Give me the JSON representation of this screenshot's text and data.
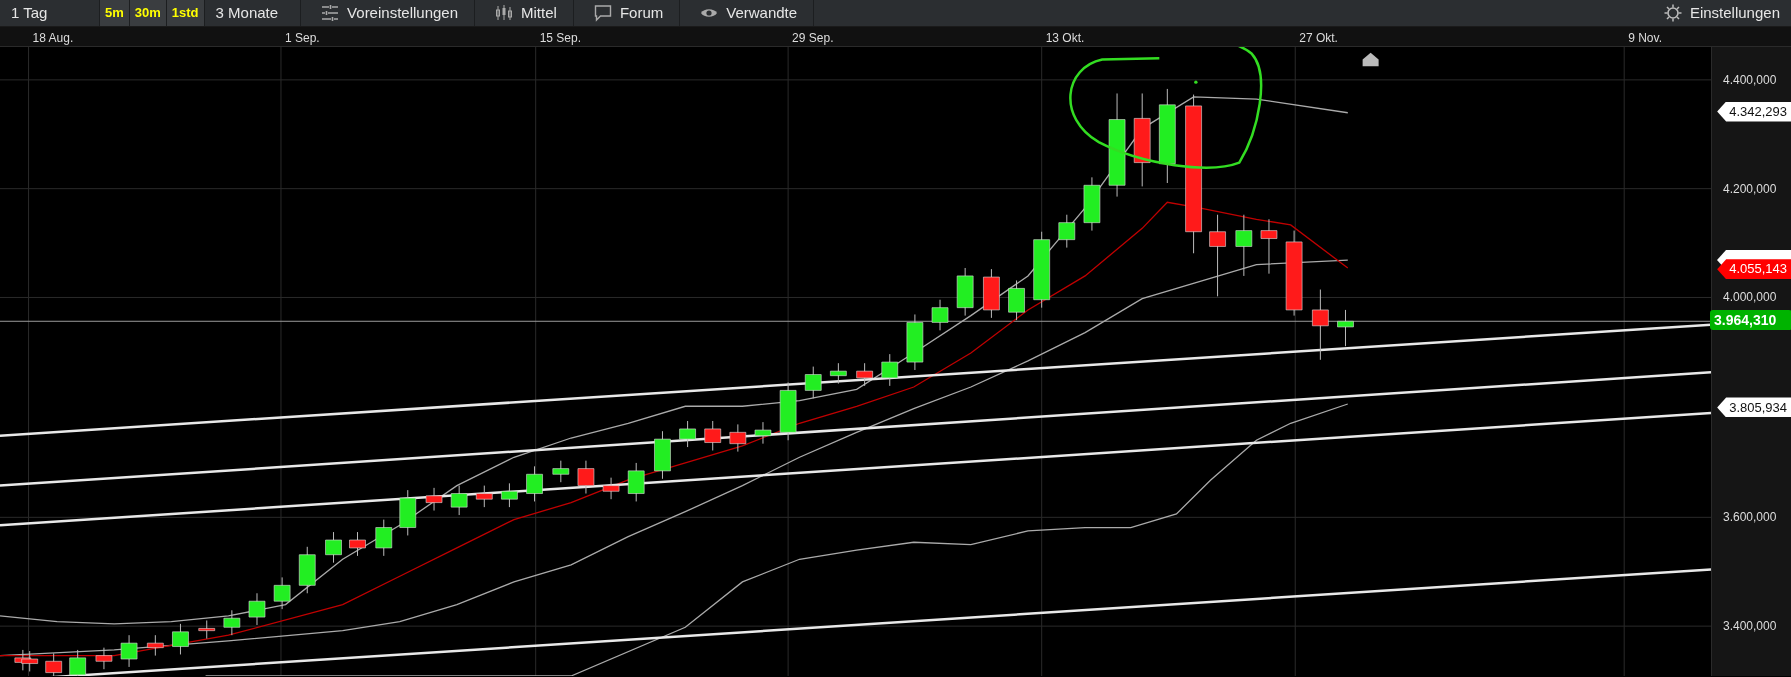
{
  "toolbar": {
    "period": "1 Tag",
    "intervals": [
      "5m",
      "30m",
      "1std"
    ],
    "range": "3 Monate",
    "buttons": [
      {
        "kind": "presets",
        "label": "Voreinstellungen"
      },
      {
        "kind": "indicators",
        "label": "Mittel"
      },
      {
        "kind": "forum",
        "label": "Forum"
      },
      {
        "kind": "related",
        "label": "Verwandte"
      }
    ],
    "settings": "Einstellungen"
  },
  "chart": {
    "dates": [
      "18 Aug.",
      "1 Sep.",
      "15 Sep.",
      "29 Sep.",
      "13 Okt.",
      "27 Okt.",
      "9 Nov."
    ],
    "price_axis": [
      "4.400,000",
      "4.200,000",
      "4.000,000",
      "3.600,000",
      "3.400,000"
    ],
    "price_tags": [
      {
        "kind": "marker",
        "text": "4.342,293",
        "color": "#ffffff"
      },
      {
        "kind": "marker",
        "color": "#ffffff"
      },
      {
        "kind": "marker",
        "text": "4.055,143",
        "color": "#ff0000"
      },
      {
        "kind": "current",
        "text": "3.964,310",
        "color": "#00b300"
      },
      {
        "kind": "marker",
        "text": "3.805,934",
        "color": "#ffffff"
      }
    ]
  }
}
